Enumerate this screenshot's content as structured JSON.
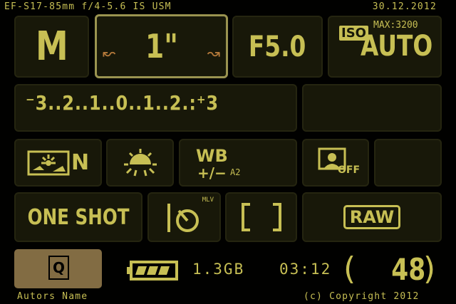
{
  "header": {
    "lens": "EF-S17-85mm f/4-5.6 IS USM",
    "date": "30.12.2012"
  },
  "mode": {
    "value": "M"
  },
  "shutter": {
    "value": "1\""
  },
  "aperture": {
    "value": "F5.0"
  },
  "iso": {
    "badge": "ISO",
    "max": "MAX:3200",
    "value": "AUTO"
  },
  "exposure": {
    "scale": "⁻3..2..1..0..1..2.:⁺3"
  },
  "wb": {
    "title": "WB",
    "adjust": "+/−",
    "shift": "A2"
  },
  "af": {
    "mode": "ONE SHOT"
  },
  "drive": {
    "label": "MLV"
  },
  "quality": {
    "value": "RAW"
  },
  "quick": {
    "label": "Q"
  },
  "picture_style": {
    "label": "N"
  },
  "auto_lighting": {
    "label": "OFF"
  },
  "status": {
    "card": "1.3GB",
    "time": "03:12",
    "shots": "48",
    "battery_level": 0.75
  },
  "footer": {
    "author": "Autors Name",
    "copyright": "(c) Copyright 2012"
  },
  "colors": {
    "accent": "#c7bf54",
    "tile": "#181809",
    "selected_border": "#9a9350",
    "q_button": "#826c43",
    "arrow": "#b4793a"
  }
}
